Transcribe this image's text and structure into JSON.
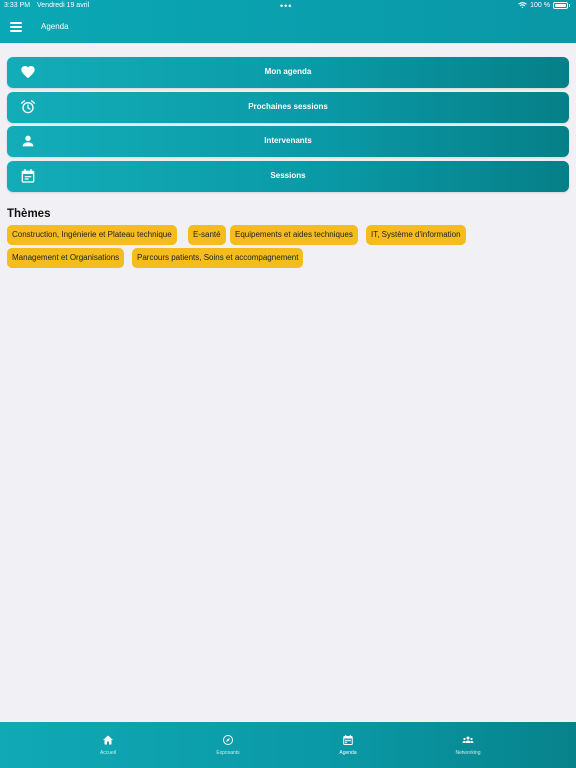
{
  "status_bar": {
    "time": "3:33 PM",
    "date": "Vendredi 19 avril",
    "battery": "100 %",
    "dots": "•••"
  },
  "header": {
    "title": "Agenda",
    "menu_icon": "hamburger-icon"
  },
  "nav_buttons": [
    {
      "label": "Mon agenda",
      "icon": "heart-icon"
    },
    {
      "label": "Prochaines sessions",
      "icon": "alarm-clock-icon"
    },
    {
      "label": "Intervenants",
      "icon": "person-icon"
    },
    {
      "label": "Sessions",
      "icon": "calendar-icon"
    }
  ],
  "themes": {
    "title": "Thèmes",
    "chips": [
      "Construction, Ingénierie et Plateau technique",
      "E-santé",
      "Equipements et aides techniques",
      "IT, Système d'information",
      "Management et Organisations",
      "Parcours patients, Soins et accompagnement"
    ]
  },
  "tabbar": {
    "tabs": [
      {
        "label": "Accueil",
        "icon": "home-icon",
        "active": false
      },
      {
        "label": "Exposants",
        "icon": "compass-icon",
        "active": false
      },
      {
        "label": "Agenda",
        "icon": "calendar-icon",
        "active": true
      },
      {
        "label": "Networking",
        "icon": "group-icon",
        "active": false
      }
    ]
  },
  "colors": {
    "teal": "#0aa3b0",
    "teal_dark": "#067f88",
    "chip": "#f4bd1d",
    "background": "#f1f1f5"
  }
}
